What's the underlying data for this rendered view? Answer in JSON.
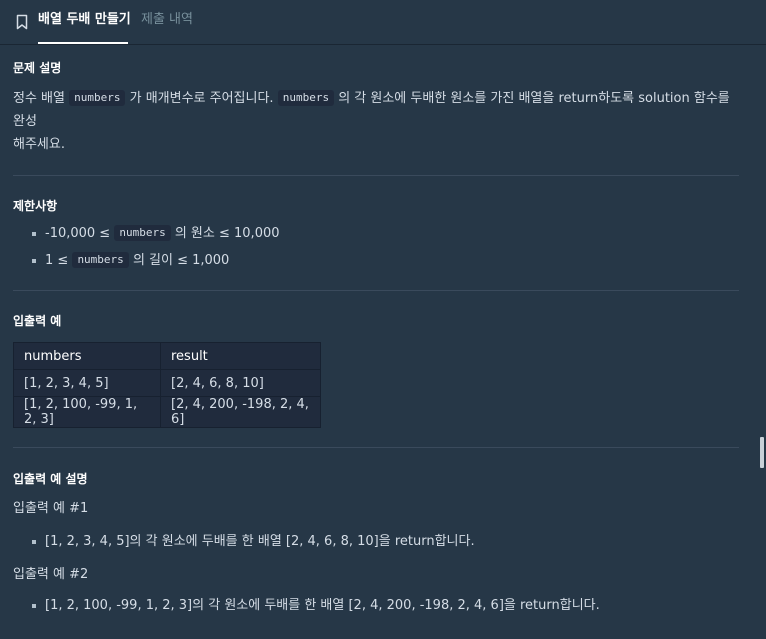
{
  "tabs": {
    "active": "배열 두배 만들기",
    "inactive": "제출 내역"
  },
  "description": {
    "heading": "문제 설명",
    "text_part1": "정수 배열 ",
    "code1": "numbers",
    "text_part2": "가 매개변수로 주어집니다. ",
    "code2": "numbers",
    "text_part3": "의 각 원소에 두배한 원소를 가진 배열을 return하도록 solution 함수를 완성",
    "text_line2": "해주세요."
  },
  "constraints": {
    "heading": "제한사항",
    "items": [
      {
        "before": "-10,000 ≤ ",
        "code": "numbers",
        "after": "의 원소 ≤ 10,000"
      },
      {
        "before": "1 ≤ ",
        "code": "numbers",
        "after": "의 길이 ≤ 1,000"
      }
    ]
  },
  "io_example": {
    "heading": "입출력 예",
    "columns": [
      "numbers",
      "result"
    ],
    "rows": [
      [
        "[1, 2, 3, 4, 5]",
        "[2, 4, 6, 8, 10]"
      ],
      [
        "[1, 2, 100, -99, 1, 2, 3]",
        "[2, 4, 200, -198, 2, 4, 6]"
      ]
    ]
  },
  "io_explanation": {
    "heading": "입출력 예 설명",
    "examples": [
      {
        "title": "입출력 예 #1",
        "bullet": "[1, 2, 3, 4, 5]의 각 원소에 두배를 한 배열 [2, 4, 6, 8, 10]을 return합니다."
      },
      {
        "title": "입출력 예 #2",
        "bullet": "[1, 2, 100, -99, 1, 2, 3]의 각 원소에 두배를 한 배열 [2, 4, 200, -198, 2, 4, 6]을 return합니다."
      }
    ]
  },
  "icons": {
    "bookmark": "bookmark-icon"
  }
}
